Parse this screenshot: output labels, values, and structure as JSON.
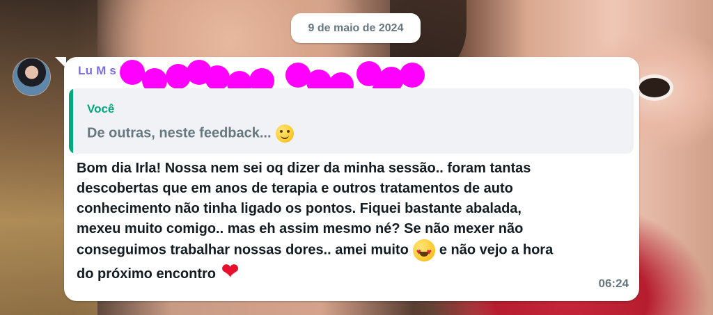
{
  "date_chip": "9 de maio de 2024",
  "message": {
    "sender_name": "Lu  M  s  P",
    "quote": {
      "author": "Você",
      "text": "De outras, neste feedback..."
    },
    "lines": [
      "Bom dia Irla! Nossa nem sei oq dizer da minha sessão.. foram tantas",
      "descobertas que em anos de terapia e outros tratamentos de auto",
      "conhecimento não tinha ligado os pontos. Fiquei bastante abalada,",
      "mexeu muito comigo.. mas eh assim mesmo né? Se não mexer não",
      "conseguimos trabalhar nossas dores.. amei muito",
      "e não vejo a hora",
      "do próximo encontro"
    ],
    "time": "06:24"
  },
  "icons": {
    "quote_emoji": "smiling-face-icon",
    "inline_emoji": "heart-eyes-icon",
    "end_emoji": "red-heart-icon"
  },
  "colors": {
    "quote_accent": "#06a77d",
    "sender_name": "#7a6de2",
    "redaction": "#ff00ff"
  }
}
